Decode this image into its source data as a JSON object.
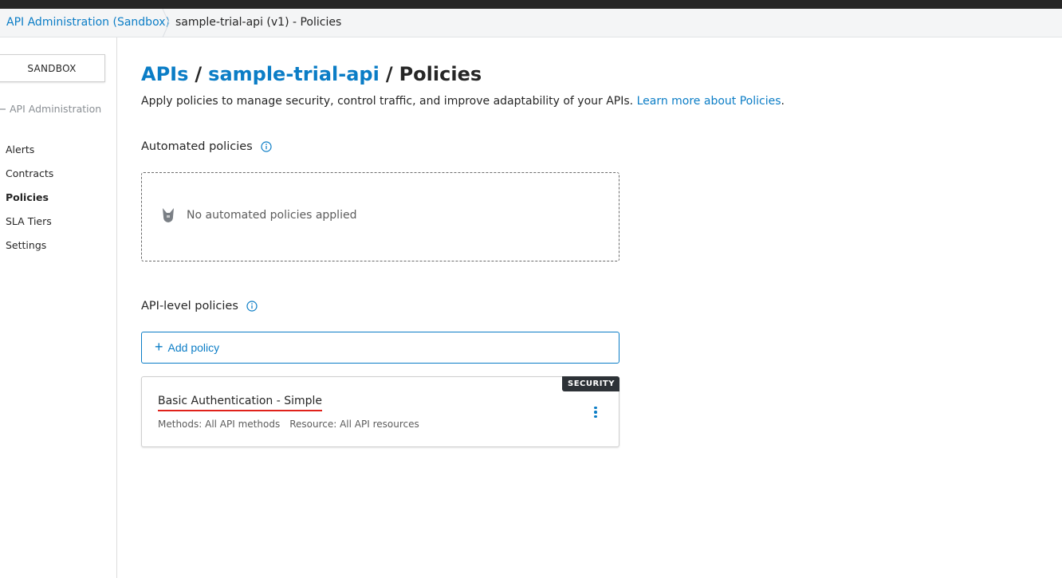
{
  "breadcrumb": {
    "root": "API Administration (Sandbox)",
    "current": "sample-trial-api (v1) - Policies"
  },
  "sidebar": {
    "environment": "SANDBOX",
    "back_label": "API Administration",
    "items": [
      {
        "label": "Alerts",
        "active": false
      },
      {
        "label": "Contracts",
        "active": false
      },
      {
        "label": "Policies",
        "active": true
      },
      {
        "label": "SLA Tiers",
        "active": false
      },
      {
        "label": "Settings",
        "active": false
      }
    ]
  },
  "page": {
    "crumb_apis": "APIs",
    "crumb_api_name": "sample-trial-api",
    "crumb_current": "Policies",
    "separator": "/",
    "description": "Apply policies to manage security, control traffic, and improve adaptability of your APIs.",
    "learn_more": "Learn more about Policies",
    "period": "."
  },
  "automated_policies": {
    "title": "Automated policies",
    "empty_message": "No automated policies applied"
  },
  "api_level_policies": {
    "title": "API-level policies",
    "add_button": "Add policy",
    "policies": [
      {
        "name": "Basic Authentication - Simple",
        "category": "SECURITY",
        "methods": "Methods: All API methods",
        "resource": "Resource: All API resources"
      }
    ]
  },
  "colors": {
    "link": "#0b7dc6",
    "text": "#262626",
    "tag_bg": "#2d3237",
    "underline": "#e0221b"
  }
}
